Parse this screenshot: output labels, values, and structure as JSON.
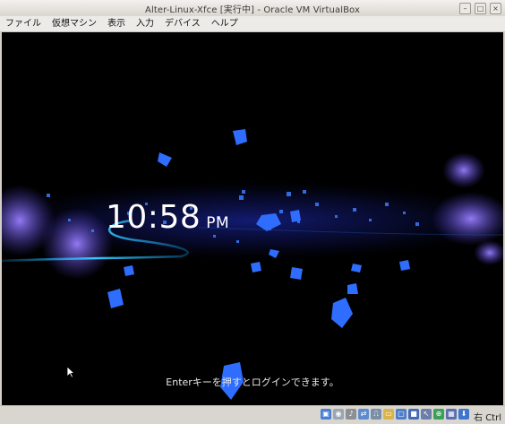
{
  "window": {
    "title": "Alter-Linux-Xfce [実行中] - Oracle VM VirtualBox"
  },
  "window_controls": [
    "minimize-icon",
    "maximize-icon",
    "close-icon"
  ],
  "menu": {
    "items": [
      "ファイル",
      "仮想マシン",
      "表示",
      "入力",
      "デバイス",
      "ヘルプ"
    ]
  },
  "login": {
    "time": "10:58",
    "ampm": "PM",
    "hint": "Enterキーを押すとログインできます。"
  },
  "statusbar": {
    "icons": [
      "storage-icon",
      "optical-disk-icon",
      "audio-icon",
      "network-icon",
      "usb-icon",
      "shared-folders-icon",
      "display-icon",
      "video-capture-icon",
      "mouse-integration-icon",
      "guest-additions-icon",
      "cpu-icon",
      "arrow-down-icon"
    ],
    "host_key": "右 Ctrl"
  },
  "colors": {
    "accent": "#3a7bff",
    "glow": "#6a55ff",
    "background": "#000000"
  }
}
